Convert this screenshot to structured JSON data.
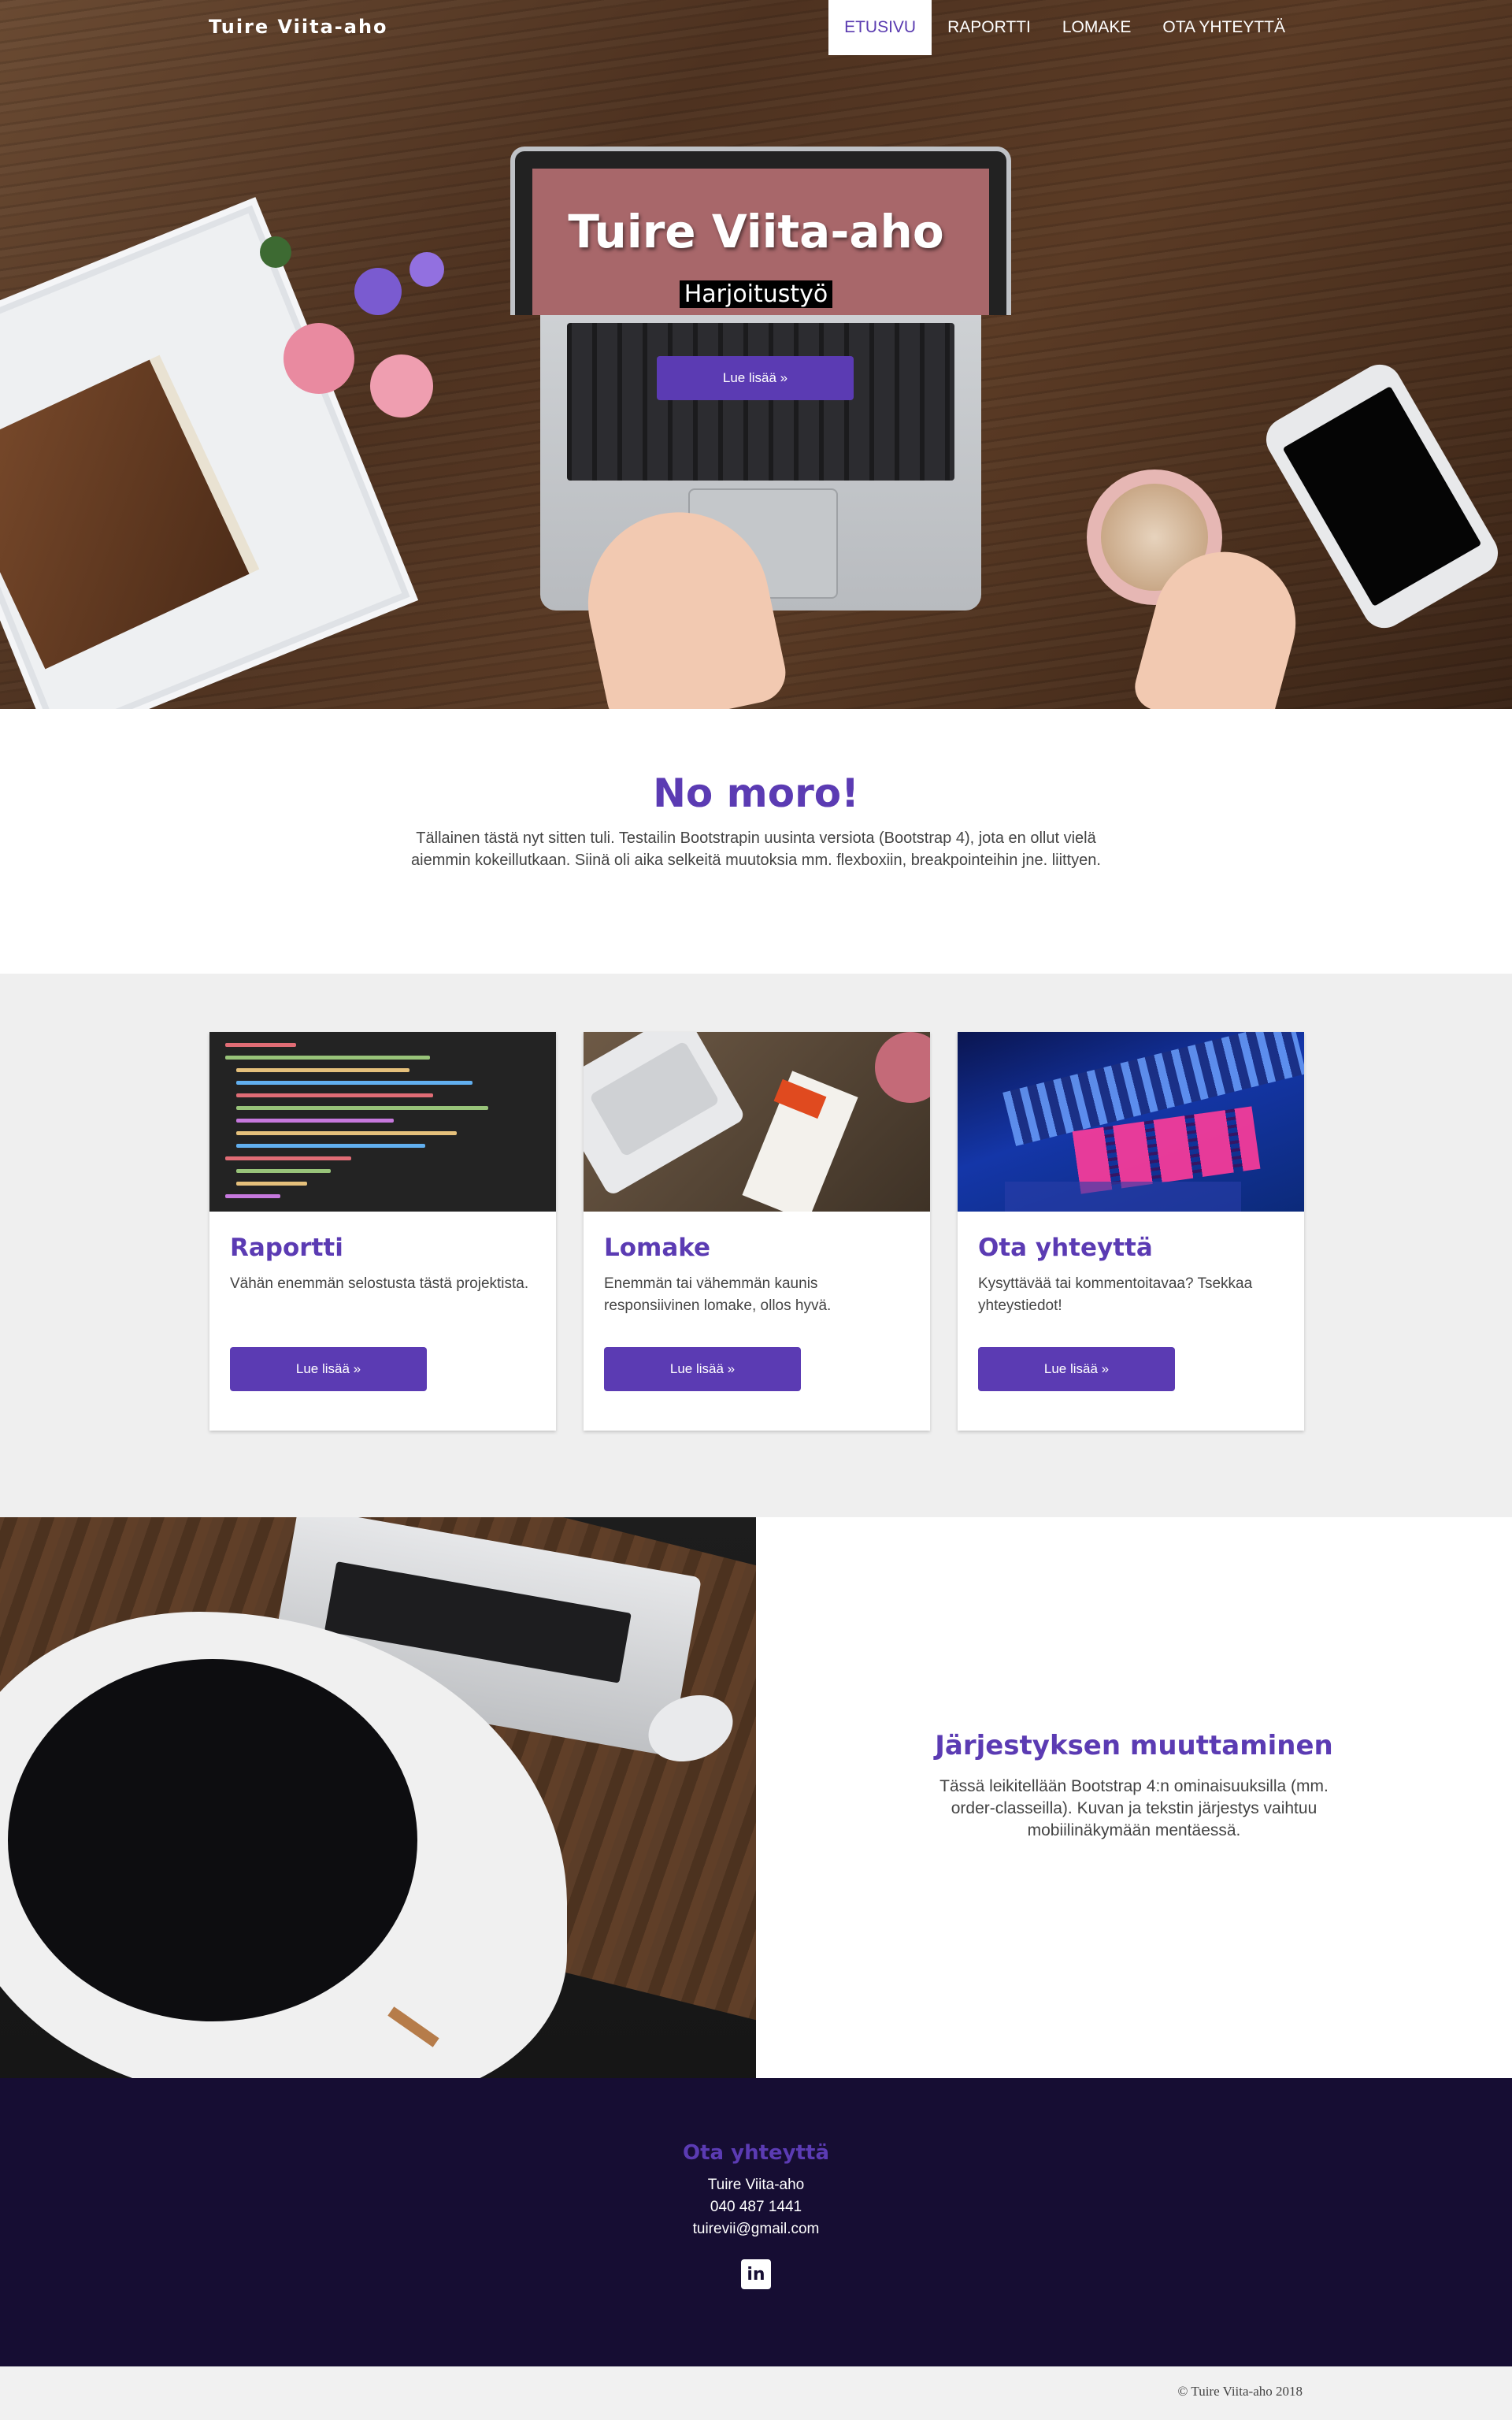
{
  "navbar": {
    "brand": "Tuire Viita-aho",
    "items": [
      {
        "label": "ETUSIVU",
        "active": true
      },
      {
        "label": "RAPORTTI",
        "active": false
      },
      {
        "label": "LOMAKE",
        "active": false
      },
      {
        "label": "OTA YHTEYTTÄ",
        "active": false
      }
    ]
  },
  "hero": {
    "title": "Tuire Viita-aho",
    "subtitle": "Harjoitustyö",
    "button_label": "Lue lisää »"
  },
  "intro": {
    "heading": "No moro!",
    "text": "Tällainen tästä nyt sitten tuli. Testailin Bootstrapin uusinta versiota (Bootstrap 4), jota en ollut vielä aiemmin kokeillutkaan. Siinä oli aika selkeitä muutoksia mm. flexboxiin, breakpointeihin jne. liittyen."
  },
  "cards": [
    {
      "title": "Raportti",
      "text": "Vähän enemmän selostusta tästä projektista.",
      "button_label": "Lue lisää »",
      "image": "code-screenshot"
    },
    {
      "title": "Lomake",
      "text": "Enemmän tai vähemmän kaunis responsiivinen lomake, ollos hyvä.",
      "button_label": "Lue lisää »",
      "image": "desk-laptop-book"
    },
    {
      "title": "Ota yhteyttä",
      "text": "Kysyttävää tai kommentoitavaa? Tsekkaa yhteystiedot!",
      "button_label": "Lue lisää »",
      "image": "music-pad"
    }
  ],
  "split": {
    "heading": "Järjestyksen muuttaminen",
    "text": "Tässä leikitellään Bootstrap 4:n ominaisuuksilla (mm. order-classeilla). Kuvan ja tekstin järjestys vaihtuu mobiilinäkymään mentäessä."
  },
  "footer": {
    "heading": "Ota yhteyttä",
    "name": "Tuire Viita-aho",
    "phone": "040 487 1441",
    "email": "tuirevii@gmail.com",
    "social_icon": "linkedin-icon"
  },
  "copyright": "© Tuire Viita-aho 2018",
  "colors": {
    "accent": "#5b3bb3",
    "footer_bg": "#160d33",
    "section_gray": "#efefef"
  }
}
